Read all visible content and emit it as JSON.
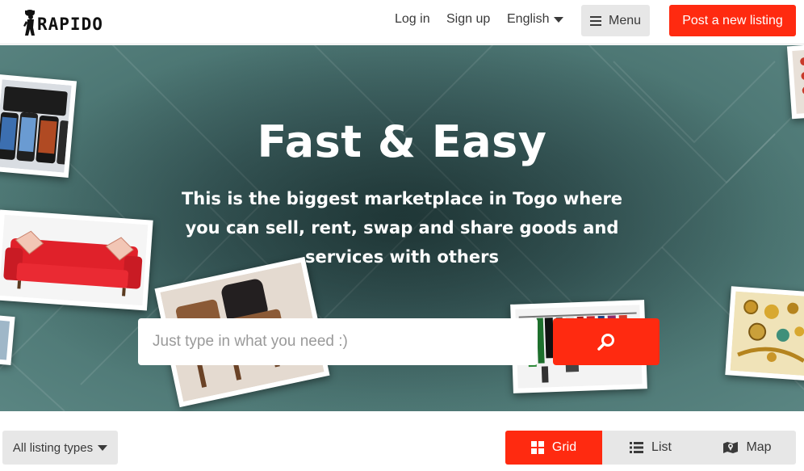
{
  "header": {
    "logo_text": "RAPIDO",
    "login_label": "Log in",
    "signup_label": "Sign up",
    "language_label": "English",
    "menu_label": "Menu",
    "post_label": "Post a new listing"
  },
  "hero": {
    "title": "Fast & Easy",
    "subtitle": "This is the biggest marketplace in Togo where you can sell, rent, swap and share goods and services with others",
    "search_placeholder": "Just type in what you need :)"
  },
  "filters": {
    "listing_types_label": "All listing types",
    "views": [
      {
        "label": "Grid",
        "icon": "grid-icon",
        "active": true
      },
      {
        "label": "List",
        "icon": "list-icon",
        "active": false
      },
      {
        "label": "Map",
        "icon": "map-icon",
        "active": false
      }
    ]
  },
  "colors": {
    "accent": "#ff2a10",
    "button_gray": "#e7e7e7",
    "hero_teal": "#3d6060"
  }
}
